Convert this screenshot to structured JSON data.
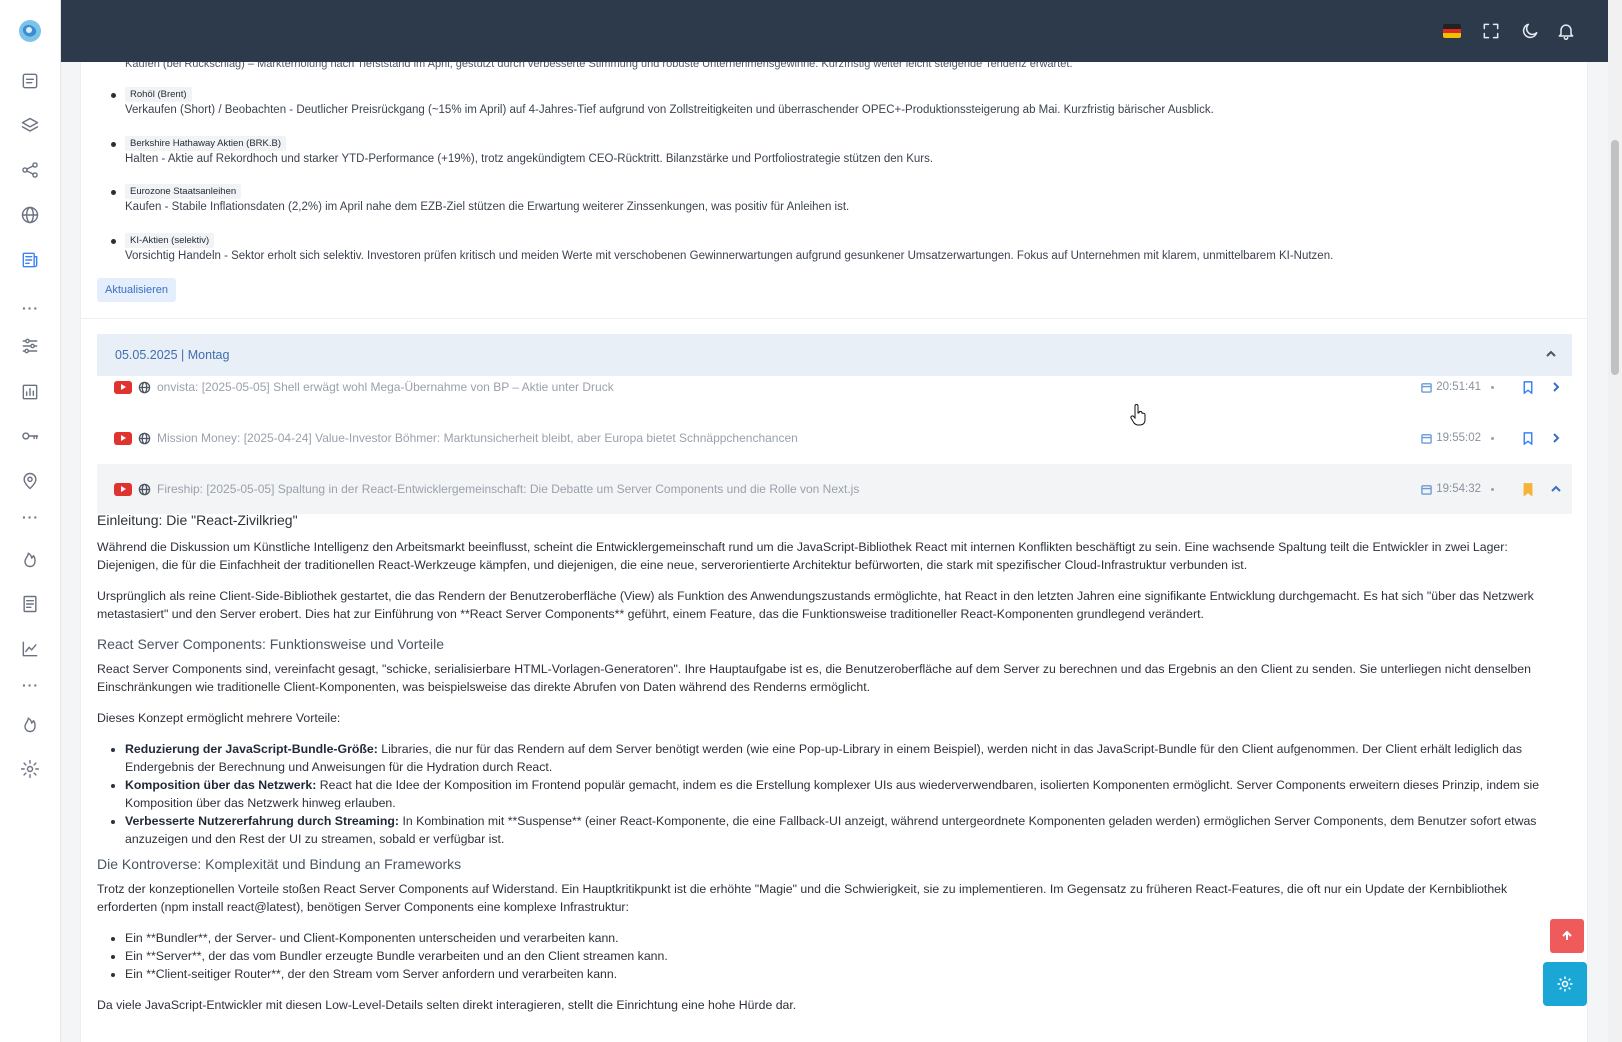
{
  "header": {
    "language_flag": "de",
    "icons": [
      "flag-de-icon",
      "fullscreen-icon",
      "moon-icon",
      "bell-icon"
    ]
  },
  "recommendations": {
    "cut_text": "Kaufen (bei Rückschlag) – Markterholung nach Tiefststand im April, gestützt durch verbesserte Stimmung und robuste Unternehmensgewinne. Kurzfristig weiter leicht steigende Tendenz erwartet.",
    "items": [
      {
        "tag": "Rohöl (Brent)",
        "text": "Verkaufen (Short) / Beobachten - Deutlicher Preisrückgang (~15% im April) auf 4-Jahres-Tief aufgrund von Zollstreitigkeiten und überraschender OPEC+-Produktionssteigerung ab Mai. Kurzfristig bärischer Ausblick."
      },
      {
        "tag": "Berkshire Hathaway Aktien (BRK.B)",
        "text": "Halten - Aktie auf Rekordhoch und starker YTD-Performance (+19%), trotz angekündigtem CEO-Rücktritt. Bilanzstärke und Portfoliostrategie stützen den Kurs."
      },
      {
        "tag": "Eurozone Staatsanleihen",
        "text": "Kaufen - Stabile Inflationsdaten (2,2%) im April nahe dem EZB-Ziel stützen die Erwartung weiterer Zinssenkungen, was positiv für Anleihen ist."
      },
      {
        "tag": "KI-Aktien (selektiv)",
        "text": "Vorsichtig Handeln - Sektor erholt sich selektiv. Investoren prüfen kritisch und meiden Werte mit verschobenen Gewinnerwartungen aufgrund gesunkener Umsatzerwartungen. Fokus auf Unternehmen mit klarem, unmittelbarem KI-Nutzen."
      }
    ],
    "update_label": "Aktualisieren"
  },
  "day": {
    "title": "05.05.2025 | Montag",
    "videos": [
      {
        "title": "onvista: [2025-05-05] Shell erwägt wohl Mega-Übernahme von BP – Aktie unter Druck",
        "time": "20:51:41",
        "bookmarked": false,
        "open": false
      },
      {
        "title": "Mission Money: [2025-04-24] Value-Investor Böhmer: Marktunsicherheit bleibt, aber Europa bietet Schnäppchenchancen",
        "time": "19:55:02",
        "bookmarked": false,
        "open": false
      },
      {
        "title": "Fireship: [2025-05-05] Spaltung in der React-Entwicklergemeinschaft: Die Debatte um Server Components und die Rolle von Next.js",
        "time": "19:54:32",
        "bookmarked": true,
        "open": true
      }
    ]
  },
  "article": {
    "h1": "Einleitung: Die \"React-Zivilkrieg\"",
    "p1": "Während die Diskussion um Künstliche Intelligenz den Arbeitsmarkt beeinflusst, scheint die Entwicklergemeinschaft rund um die JavaScript-Bibliothek React mit internen Konflikten beschäftigt zu sein. Eine wachsende Spaltung teilt die Entwickler in zwei Lager: Diejenigen, die für die Einfachheit der traditionellen React-Werkzeuge kämpfen, und diejenigen, die eine neue, serverorientierte Architektur befürworten, die stark mit spezifischer Cloud-Infrastruktur verbunden ist.",
    "p2": "Ursprünglich als reine Client-Side-Bibliothek gestartet, die das Rendern der Benutzeroberfläche (View) als Funktion des Anwendungszustands ermöglichte, hat React in den letzten Jahren eine signifikante Entwicklung durchgemacht. Es hat sich \"über das Netzwerk metastasiert\" und den Server erobert. Dies hat zur Einführung von **React Server Components** geführt, einem Feature, das die Funktionsweise traditioneller React-Komponenten grundlegend verändert.",
    "h2": "React Server Components: Funktionsweise und Vorteile",
    "p3": "React Server Components sind, vereinfacht gesagt, \"schicke, serialisierbare HTML-Vorlagen-Generatoren\". Ihre Hauptaufgabe ist es, die Benutzeroberfläche auf dem Server zu berechnen und das Ergebnis an den Client zu senden. Sie unterliegen nicht denselben Einschränkungen wie traditionelle Client-Komponenten, was beispielsweise das direkte Abrufen von Daten während des Renderns ermöglicht.",
    "p4": "Dieses Konzept ermöglicht mehrere Vorteile:",
    "benefits": [
      {
        "bold": "Reduzierung der JavaScript-Bundle-Größe:",
        "text": " Libraries, die nur für das Rendern auf dem Server benötigt werden (wie eine Pop-up-Library in einem Beispiel), werden nicht in das JavaScript-Bundle für den Client aufgenommen. Der Client erhält lediglich das Endergebnis der Berechnung und Anweisungen für die Hydration durch React."
      },
      {
        "bold": "Komposition über das Netzwerk:",
        "text": " React hat die Idee der Komposition im Frontend populär gemacht, indem es die Erstellung komplexer UIs aus wiederverwendbaren, isolierten Komponenten ermöglicht. Server Components erweitern dieses Prinzip, indem sie Komposition über das Netzwerk hinweg erlauben."
      },
      {
        "bold": "Verbesserte Nutzererfahrung durch Streaming:",
        "text": " In Kombination mit **Suspense** (einer React-Komponente, die eine Fallback-UI anzeigt, während untergeordnete Komponenten geladen werden) ermöglichen Server Components, dem Benutzer sofort etwas anzuzeigen und den Rest der UI zu streamen, sobald er verfügbar ist."
      }
    ],
    "h3": "Die Kontroverse: Komplexität und Bindung an Frameworks",
    "p5": "Trotz der konzeptionellen Vorteile stoßen React Server Components auf Widerstand. Ein Hauptkritikpunkt ist die erhöhte \"Magie\" und die Schwierigkeit, sie zu implementieren. Im Gegensatz zu früheren React-Features, die oft nur ein Update der Kernbibliothek erforderten (npm install react@latest), benötigen Server Components eine komplexe Infrastruktur:",
    "infra": [
      "Ein **Bundler**, der Server- und Client-Komponenten unterscheiden und verarbeiten kann.",
      "Ein **Server**, der das vom Bundler erzeugte Bundle verarbeiten und an den Client streamen kann.",
      "Ein **Client-seitiger Router**, der den Stream vom Server anfordern und verarbeiten kann."
    ],
    "p6": "Da viele JavaScript-Entwickler mit diesen Low-Level-Details selten direkt interagieren, stellt die Einrichtung eine hohe Hürde dar."
  },
  "colors": {
    "header_bg": "#2c3a4b",
    "accent": "#3b82f6",
    "scroll_top": "#ef5a5a",
    "settings_fab": "#1ba7d6",
    "bookmark_active": "#f6b337"
  }
}
